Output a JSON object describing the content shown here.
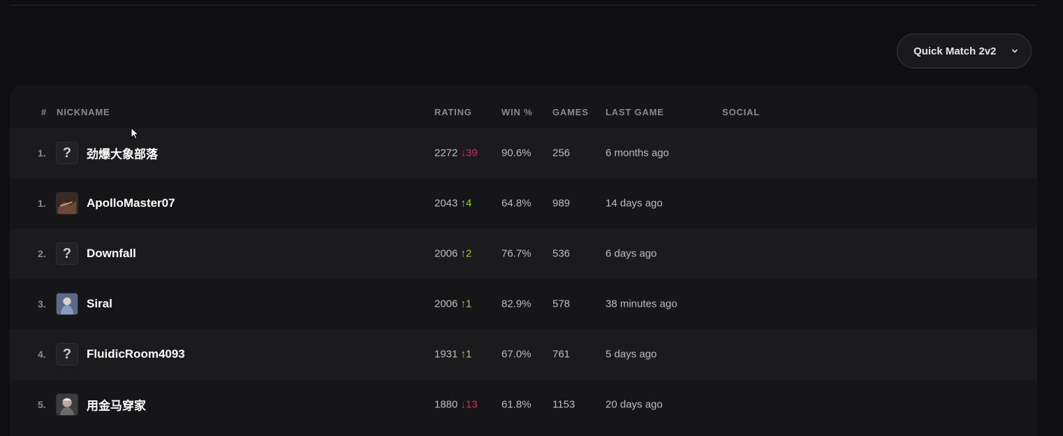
{
  "mode_selector": {
    "label": "Quick Match 2v2",
    "icon": "chevron-down-icon"
  },
  "table": {
    "headers": {
      "rank": "#",
      "nickname": "NICKNAME",
      "rating": "RATING",
      "win": "WIN %",
      "games": "GAMES",
      "last_game": "LAST GAME",
      "social": "SOCIAL"
    },
    "rows": [
      {
        "rank": "1.",
        "avatar": "unknown",
        "nickname": "劲爆大象部落",
        "rating": "2272",
        "delta_arrow": "↓",
        "delta": "39",
        "trend": "down",
        "win": "90.6%",
        "games": "256",
        "last_game": "6 months ago"
      },
      {
        "rank": "1.",
        "avatar": "image",
        "nickname": "ApolloMaster07",
        "rating": "2043",
        "delta_arrow": "↑",
        "delta": "4",
        "trend": "up",
        "win": "64.8%",
        "games": "989",
        "last_game": "14 days ago"
      },
      {
        "rank": "2.",
        "avatar": "unknown",
        "nickname": "Downfall",
        "rating": "2006",
        "delta_arrow": "↑",
        "delta": "2",
        "trend": "up",
        "win": "76.7%",
        "games": "536",
        "last_game": "6 days ago"
      },
      {
        "rank": "3.",
        "avatar": "image",
        "nickname": "Siral",
        "rating": "2006",
        "delta_arrow": "↑",
        "delta": "1",
        "trend": "up",
        "win": "82.9%",
        "games": "578",
        "last_game": "38 minutes ago"
      },
      {
        "rank": "4.",
        "avatar": "unknown",
        "nickname": "FluidicRoom4093",
        "rating": "1931",
        "delta_arrow": "↑",
        "delta": "1",
        "trend": "up",
        "win": "67.0%",
        "games": "761",
        "last_game": "5 days ago"
      },
      {
        "rank": "5.",
        "avatar": "image",
        "nickname": "用金马穿家",
        "rating": "1880",
        "delta_arrow": "↓",
        "delta": "13",
        "trend": "down",
        "win": "61.8%",
        "games": "1153",
        "last_game": "20 days ago"
      }
    ]
  },
  "colors": {
    "up": "#9bd63b",
    "down": "#e0245e",
    "background": "#0f0f11"
  }
}
